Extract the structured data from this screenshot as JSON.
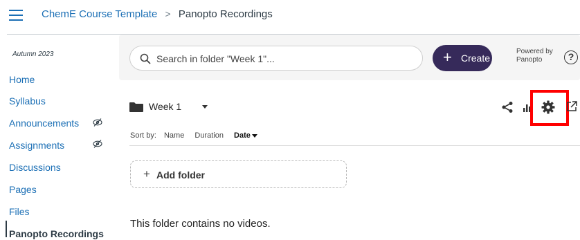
{
  "breadcrumb": {
    "course": "ChemE Course Template",
    "separator": ">",
    "current": "Panopto Recordings"
  },
  "sidebar": {
    "term": "Autumn 2023",
    "items": [
      {
        "label": "Home",
        "hidden": false
      },
      {
        "label": "Syllabus",
        "hidden": false
      },
      {
        "label": "Announcements",
        "hidden": true
      },
      {
        "label": "Assignments",
        "hidden": true
      },
      {
        "label": "Discussions",
        "hidden": false
      },
      {
        "label": "Pages",
        "hidden": false
      },
      {
        "label": "Files",
        "hidden": false
      },
      {
        "label": "Panopto Recordings",
        "hidden": false,
        "active": true
      }
    ]
  },
  "panopto": {
    "search_placeholder": "Search in folder \"Week 1\"...",
    "create_plus": "+",
    "create_label": "Create",
    "powered_by_line1": "Powered by",
    "powered_by_line2": "Panopto",
    "help_symbol": "?",
    "folder_name": "Week 1",
    "sort": {
      "label": "Sort by:",
      "options": [
        "Name",
        "Duration",
        "Date"
      ],
      "selected": "Date"
    },
    "add_folder_plus": "+",
    "add_folder_label": "Add folder",
    "empty_message": "This folder contains no videos."
  },
  "colors": {
    "link": "#1b6fb5",
    "create_button": "#362a5a",
    "highlight": "#ff0000",
    "search_bar_bg": "#f5f5f5"
  },
  "icons": [
    "hamburger-icon",
    "eye-slash-icon",
    "search-icon",
    "folder-icon",
    "share-icon",
    "stats-icon",
    "gear-icon",
    "external-link-icon",
    "help-icon"
  ]
}
